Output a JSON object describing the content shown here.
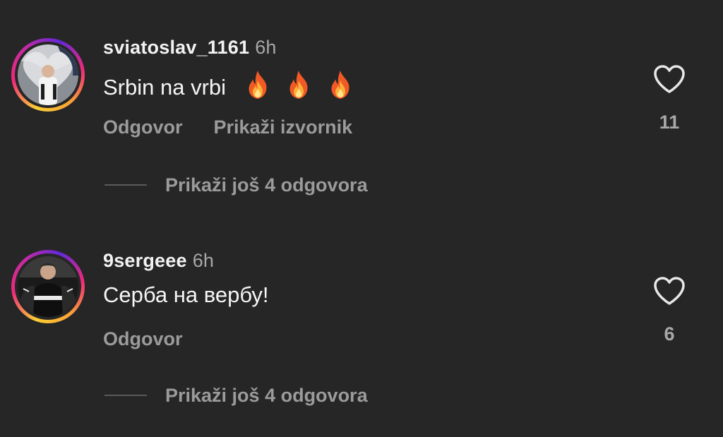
{
  "comments": [
    {
      "username": "sviatoslav_1161",
      "time": "6h",
      "text": "Srbin na vrbi",
      "emoji": [
        "🔥",
        "🔥",
        "🔥"
      ],
      "actions": {
        "reply": "Odgovor",
        "show_original": "Prikaži izvornik"
      },
      "likes": "11",
      "view_replies": "Prikaži još 4 odgovora"
    },
    {
      "username": "9sergeee",
      "time": "6h",
      "text": "Серба на вербу!",
      "actions": {
        "reply": "Odgovor"
      },
      "likes": "6",
      "view_replies": "Prikaži još 4 odgovora"
    }
  ],
  "colors": {
    "background": "#262626",
    "primary_text": "#f5f5f5",
    "secondary_text": "#a8a8a8",
    "story_ring": [
      "#f9ce34",
      "#ee2a7b",
      "#6228d7"
    ]
  },
  "icons": {
    "like": "heart-outline-icon",
    "emoji": "fire-emoji"
  }
}
